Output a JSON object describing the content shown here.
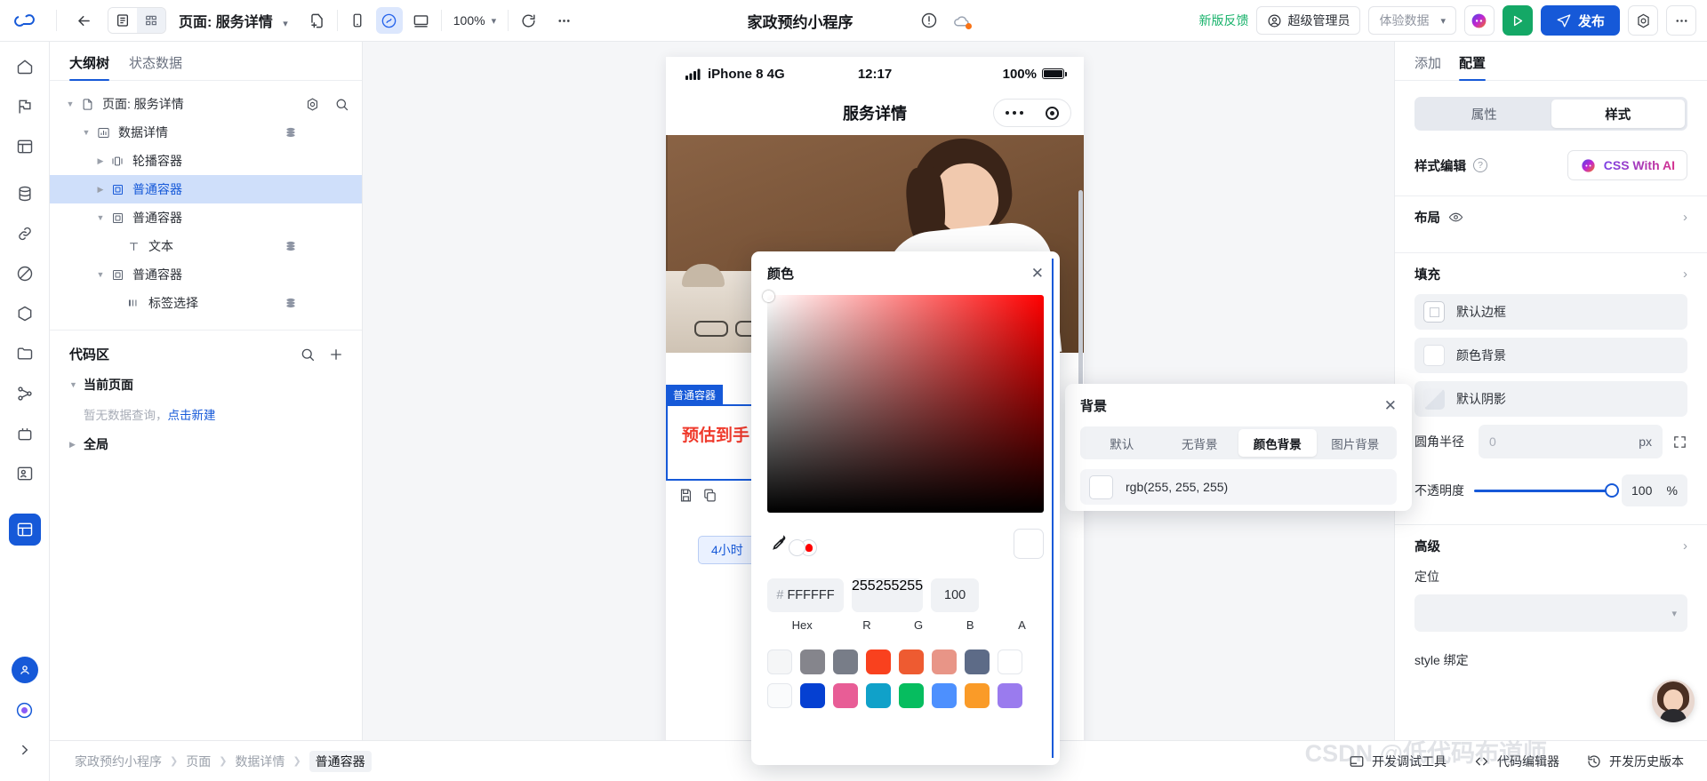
{
  "toolbar": {
    "back_icon": "arrow-left-icon",
    "view_list_icon": "list-view-icon",
    "view_grid_icon": "grid-view-icon",
    "page_label": "页面: 服务详情",
    "new_page_icon": "new-page-icon",
    "device_mobile_icon": "mobile-device-icon",
    "device_miniprogram_icon": "miniprogram-icon",
    "device_desktop_icon": "desktop-device-icon",
    "zoom_level": "100%",
    "refresh_icon": "refresh-icon",
    "more_icon": "more-horizontal-icon",
    "app_title": "家政预约小程序",
    "warning_icon": "exclamation-circle-icon",
    "cloud_icon": "cloud-sync-icon",
    "feedback_link": "新版反馈",
    "role_label": "超级管理员",
    "role_icon": "user-circle-icon",
    "env_label": "体验数据",
    "ai_icon": "ai-assistant-icon",
    "preview_icon": "play-icon",
    "publish_label": "发布",
    "publish_icon": "send-icon",
    "settings_icon": "gear-icon",
    "overflow_icon": "more-horizontal-icon"
  },
  "rail": {
    "items": [
      {
        "name": "home-icon"
      },
      {
        "name": "flag-icon"
      },
      {
        "name": "apps-icon"
      },
      {
        "name": "database-icon"
      },
      {
        "name": "link-icon"
      },
      {
        "name": "shield-icon"
      },
      {
        "name": "cube-icon"
      },
      {
        "name": "folder-icon"
      },
      {
        "name": "workflow-icon"
      },
      {
        "name": "plugin-icon"
      },
      {
        "name": "team-icon"
      },
      {
        "name": "layout-icon"
      }
    ],
    "bottom": [
      {
        "name": "profile-avatar-icon"
      },
      {
        "name": "help-icon"
      },
      {
        "name": "expand-rail-icon"
      }
    ]
  },
  "left_panel": {
    "tabs": [
      {
        "label": "大纲树",
        "active": true
      },
      {
        "label": "状态数据",
        "active": false
      }
    ],
    "tree": [
      {
        "label": "页面: 服务详情",
        "icon": "page-icon",
        "indent": 0,
        "twist": "down",
        "selected": false,
        "stack": false,
        "tools": true
      },
      {
        "label": "数据详情",
        "icon": "chart-icon",
        "indent": 1,
        "twist": "down",
        "selected": false,
        "stack": true,
        "tools": false
      },
      {
        "label": "轮播容器",
        "icon": "carousel-icon",
        "indent": 2,
        "twist": "right",
        "selected": false,
        "stack": false,
        "tools": false
      },
      {
        "label": "普通容器",
        "icon": "container-icon",
        "indent": 2,
        "twist": "right",
        "selected": true,
        "stack": false,
        "tools": false
      },
      {
        "label": "普通容器",
        "icon": "container-icon",
        "indent": 2,
        "twist": "down",
        "selected": false,
        "stack": false,
        "tools": false
      },
      {
        "label": "文本",
        "icon": "text-icon",
        "indent": 3,
        "twist": "none",
        "selected": false,
        "stack": true,
        "tools": false
      },
      {
        "label": "普通容器",
        "icon": "container-icon",
        "indent": 2,
        "twist": "down",
        "selected": false,
        "stack": false,
        "tools": false
      },
      {
        "label": "标签选择",
        "icon": "tag-select-icon",
        "indent": 3,
        "twist": "none",
        "selected": false,
        "stack": true,
        "tools": false
      }
    ],
    "tree_tools": {
      "settings_icon": "gear-icon",
      "search_icon": "search-icon"
    },
    "code_zone": {
      "title": "代码区",
      "search_icon": "search-icon",
      "add_icon": "plus-icon",
      "group_current": "当前页面",
      "empty_text": "暂无数据查询，",
      "empty_link": "点击新建",
      "group_global": "全局"
    }
  },
  "canvas": {
    "phone": {
      "status_signal": "signal-icon",
      "status_carrier": "iPhone 8  4G",
      "status_time": "12:17",
      "status_battery_pct": "100%",
      "nav_title": "服务详情",
      "capsule_more_icon": "capsule-more-icon",
      "capsule_target_icon": "capsule-target-icon",
      "selection_badge": "普通容器",
      "price_text": "预估到手",
      "chip_text": "4小时",
      "toolbar_save_icon": "save-icon",
      "toolbar_copy_icon": "copy-icon"
    }
  },
  "right_panel": {
    "tabs": [
      {
        "label": "添加",
        "active": false
      },
      {
        "label": "配置",
        "active": true
      }
    ],
    "switcher": [
      {
        "label": "属性",
        "active": false
      },
      {
        "label": "样式",
        "active": true
      }
    ],
    "style_edit_label": "样式编辑",
    "help_icon": "question-circle-icon",
    "css_ai_label": "CSS With AI",
    "css_ai_icon": "ai-sparkle-icon",
    "layout_label": "布局",
    "layout_eye_icon": "eye-icon",
    "fill_label": "填充",
    "fields": [
      {
        "label": "默认边框",
        "swatch": "border",
        "icon": "border-swatch-icon"
      },
      {
        "label": "颜色背景",
        "swatch": "white",
        "icon": "color-swatch-icon"
      },
      {
        "label": "默认阴影",
        "swatch": "shadow",
        "icon": "shadow-swatch-icon"
      }
    ],
    "radius_label": "圆角半径",
    "radius_value": "0",
    "radius_unit": "px",
    "radius_expand_icon": "expand-corners-icon",
    "opacity_label": "不透明度",
    "opacity_value": "100",
    "opacity_unit": "%",
    "advanced_label": "高级",
    "position_label": "定位",
    "position_value": "",
    "style_bind_label": "style 绑定"
  },
  "bottom_bar": {
    "breadcrumb": [
      "家政预约小程序",
      "页面",
      "数据详情",
      "普通容器"
    ],
    "items": [
      {
        "label": "开发调试工具",
        "icon": "debug-tool-icon"
      },
      {
        "label": "代码编辑器",
        "icon": "code-editor-icon"
      },
      {
        "label": "开发历史版本",
        "icon": "history-icon"
      }
    ]
  },
  "background_dialog": {
    "title": "背景",
    "close_icon": "close-icon",
    "tabs": [
      {
        "label": "默认",
        "active": false
      },
      {
        "label": "无背景",
        "active": false
      },
      {
        "label": "颜色背景",
        "active": true
      },
      {
        "label": "图片背景",
        "active": false
      }
    ],
    "value": "rgb(255, 255, 255)"
  },
  "color_dialog": {
    "title": "颜色",
    "close_icon": "close-icon",
    "eyedropper_icon": "eyedropper-icon",
    "hex_hash": "#",
    "hex_value": "FFFFFF",
    "r_value": "255",
    "g_value": "255",
    "b_value": "255",
    "a_value": "100",
    "labels": {
      "hex": "Hex",
      "r": "R",
      "g": "G",
      "b": "B",
      "a": "A"
    },
    "swatches_row1": [
      "#f5f6f7",
      "#85858c",
      "#787d88",
      "#f9411e",
      "#ee5b31",
      "#e89587",
      "#5d6b87",
      "#ffffff"
    ],
    "swatches_row2": [
      "#fafbfc",
      "#0540d2",
      "#e85d96",
      "#10a1c9",
      "#06bd5f",
      "#4d90fe",
      "#fa9b28",
      "#9a7bee"
    ]
  },
  "watermark": "CSDN @低代码布道师"
}
